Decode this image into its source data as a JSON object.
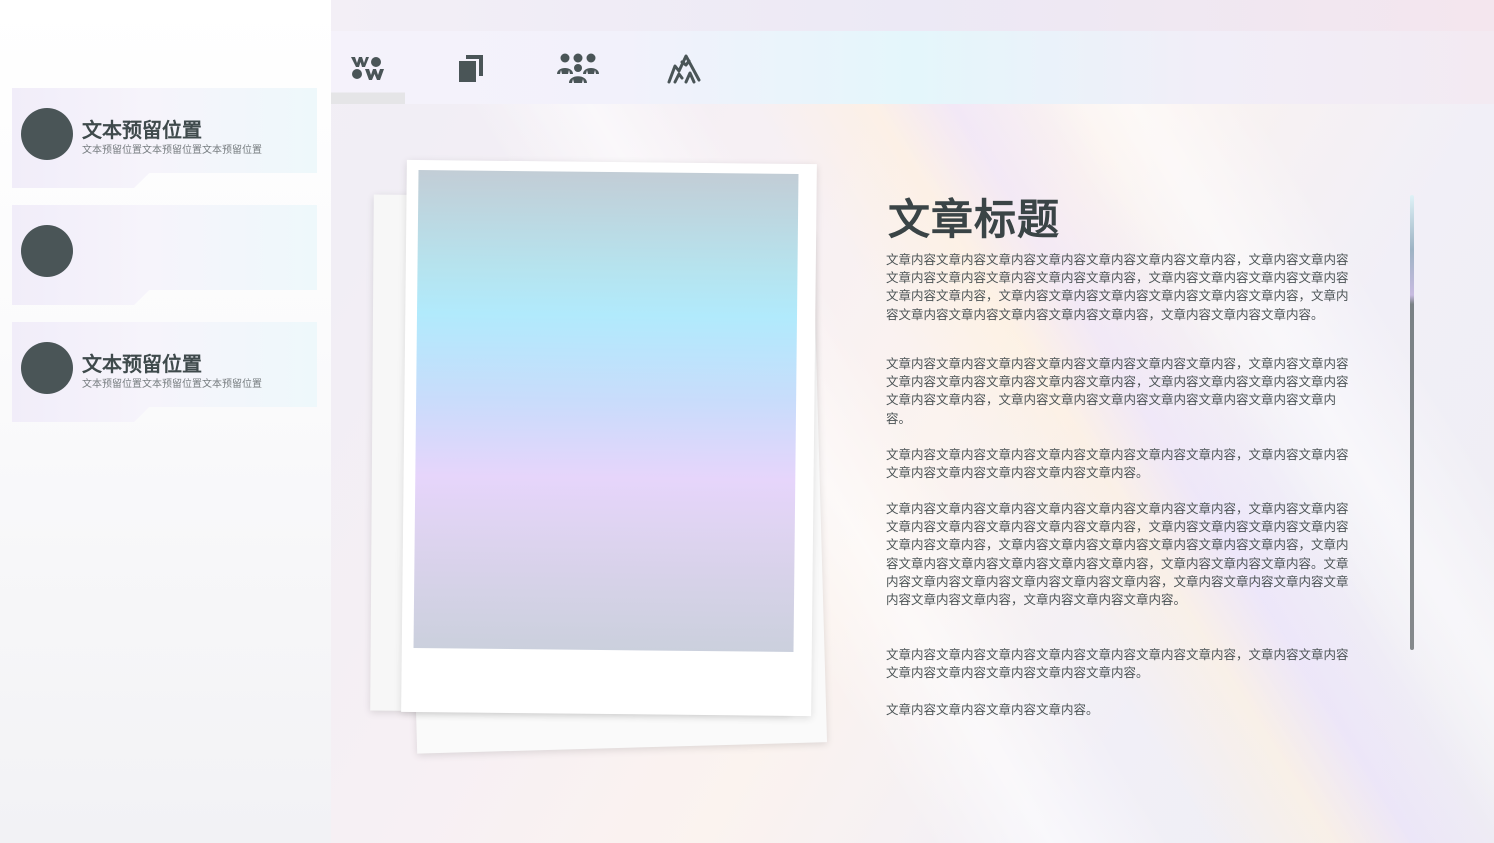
{
  "sidebar": {
    "cards": [
      {
        "title": "文本预留位置",
        "subtitle": "文本预留位置文本预留位置文本预留位置"
      },
      {
        "title": "",
        "subtitle": ""
      },
      {
        "title": "文本预留位置",
        "subtitle": "文本预留位置文本预留位置文本预留位置"
      }
    ]
  },
  "nav": {
    "icons": [
      "people-dots-icon",
      "copy-icon",
      "group-icon",
      "mountain-icon"
    ]
  },
  "article": {
    "title": "文章标题",
    "paragraphs": [
      "文章内容文章内容文章内容文章内容文章内容文章内容文章内容，文章内容文章内容文章内容文章内容文章内容文章内容文章内容，文章内容文章内容文章内容文章内容文章内容文章内容，文章内容文章内容文章内容文章内容文章内容文章内容，文章内容文章内容文章内容文章内容文章内容文章内容，文章内容文章内容文章内容。",
      "文章内容文章内容文章内容文章内容文章内容文章内容文章内容，文章内容文章内容文章内容文章内容文章内容文章内容文章内容，文章内容文章内容文章内容文章内容文章内容文章内容，文章内容文章内容文章内容文章内容文章内容文章内容文章内容。",
      "文章内容文章内容文章内容文章内容文章内容文章内容文章内容，文章内容文章内容文章内容文章内容文章内容文章内容文章内容。",
      "文章内容文章内容文章内容文章内容文章内容文章内容文章内容，文章内容文章内容文章内容文章内容文章内容文章内容文章内容，文章内容文章内容文章内容文章内容文章内容文章内容，文章内容文章内容文章内容文章内容文章内容文章内容，文章内容文章内容文章内容文章内容文章内容文章内容，文章内容文章内容文章内容。文章内容文章内容文章内容文章内容文章内容文章内容，文章内容文章内容文章内容文章内容文章内容文章内容，文章内容文章内容文章内容。",
      "文章内容文章内容文章内容文章内容文章内容文章内容文章内容，文章内容文章内容文章内容文章内容文章内容文章内容文章内容。",
      "文章内容文章内容文章内容文章内容。"
    ]
  },
  "colors": {
    "dot": "#4a5557",
    "text_dark": "#3a4446",
    "icon": "#4a5557"
  }
}
